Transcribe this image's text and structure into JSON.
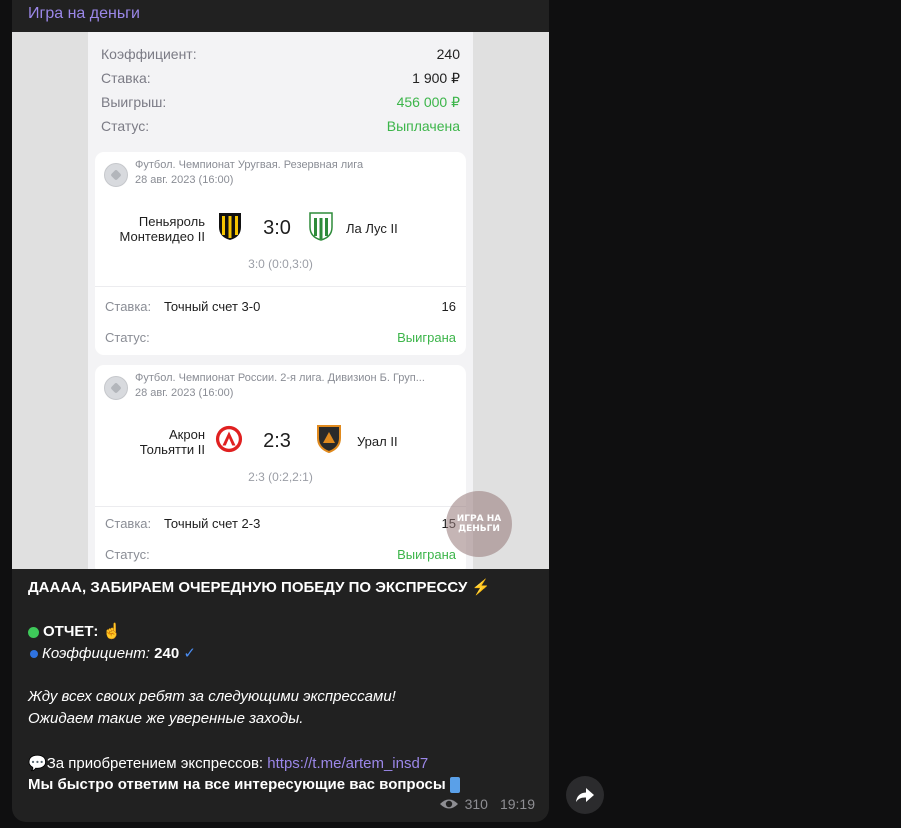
{
  "channel": {
    "name": "Игра на деньги"
  },
  "coupon": {
    "summary": [
      {
        "label": "Коэффициент:",
        "value": "240",
        "color": "#222222"
      },
      {
        "label": "Ставка:",
        "value": "1 900 ₽",
        "color": "#222222"
      },
      {
        "label": "Выигрыш:",
        "value": "456 000 ₽",
        "color": "#3cb54a"
      },
      {
        "label": "Статус:",
        "value": "Выплачена",
        "color": "#3cb54a"
      }
    ],
    "matches": [
      {
        "league": "Футбол. Чемпионат Уругвая. Резервная лига",
        "date": "28 авг. 2023 (16:00)",
        "home_line1": "Пеньяроль",
        "home_line2": "Монтевидео II",
        "away": "Ла Лус II",
        "score": "3:0",
        "detail": "3:0 (0:0,3:0)",
        "bet_label": "Ставка:",
        "bet_value": "Точный счет 3-0",
        "odds": "16",
        "status_label": "Статус:",
        "status": "Выиграна"
      },
      {
        "league": "Футбол. Чемпионат России. 2-я лига. Дивизион Б. Груп...",
        "date": "28 авг. 2023 (16:00)",
        "home_line1": "Акрон",
        "home_line2": "Тольятти II",
        "away": "Урал II",
        "score": "2:3",
        "detail": "2:3 (0:2,2:1)",
        "bet_label": "Ставка:",
        "bet_value": "Точный счет 2-3",
        "odds": "15",
        "status_label": "Статус:",
        "status": "Выиграна"
      }
    ],
    "watermark": "ИГРА НА ДЕНЬГИ"
  },
  "message": {
    "headline": "ДАААА, ЗАБИРАЕМ ОЧЕРЕДНУЮ ПОБЕДУ ПО ЭКСПРЕССУ",
    "report_label": "ОТЧЕТ:",
    "coef_label": "Коэффициент:",
    "coef_value": "240",
    "line1": "Жду всех своих ребят за следующими экспрессами!",
    "line2": "Ожидаем такие же уверенные заходы.",
    "purchase_text": "За приобретением экспрессов: ",
    "purchase_link": "https://t.me/artem_insd7",
    "reply_text": "Мы быстро ответим на все интересующие вас вопросы",
    "views": "310",
    "time": "19:19"
  },
  "colors": {
    "accent": "#9b87e8",
    "win": "#3cb54a",
    "bubble": "#212121"
  },
  "icons": [
    "eye-icon",
    "share-icon",
    "speech-bubble-icon",
    "pointing-hand-icon",
    "lightning-icon",
    "checkmark-icon",
    "phone-icon"
  ]
}
